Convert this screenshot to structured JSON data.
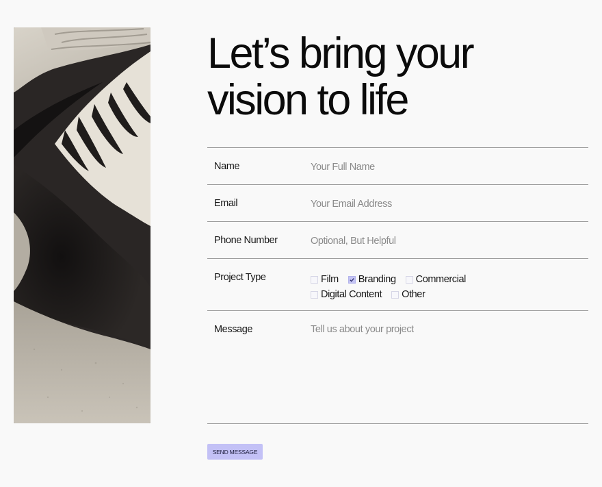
{
  "headline": {
    "line1": "Let’s bring your",
    "line2": "vision to life"
  },
  "form": {
    "name": {
      "label": "Name",
      "placeholder": "Your Full Name",
      "value": ""
    },
    "email": {
      "label": "Email",
      "placeholder": "Your Email Address",
      "value": ""
    },
    "phone": {
      "label": "Phone Number",
      "placeholder": "Optional, But Helpful",
      "value": ""
    },
    "project_type": {
      "label": "Project Type",
      "options": [
        {
          "label": "Film",
          "checked": false
        },
        {
          "label": "Branding",
          "checked": true
        },
        {
          "label": "Commercial",
          "checked": false
        },
        {
          "label": "Digital Content",
          "checked": false
        },
        {
          "label": "Other",
          "checked": false
        }
      ]
    },
    "message": {
      "label": "Message",
      "placeholder": "Tell us about your project",
      "value": ""
    },
    "submit_label": "SEND MESSAGE"
  },
  "colors": {
    "background": "#f9f9f9",
    "accent": "#c3c1f6",
    "divider": "#9c9c9c"
  }
}
